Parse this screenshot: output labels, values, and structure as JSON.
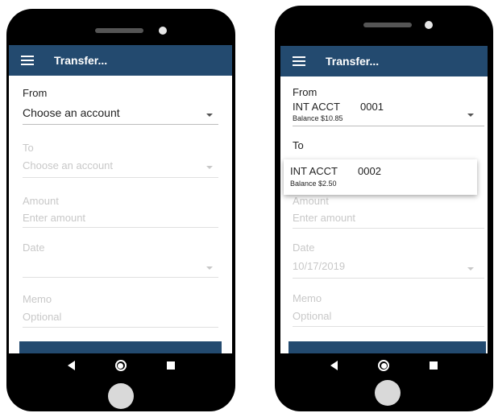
{
  "left": {
    "title": "Transfer...",
    "from_label": "From",
    "from_value": "Choose an account",
    "to_label": "To",
    "to_value": "Choose an account",
    "amount_label": "Amount",
    "amount_placeholder": "Enter amount",
    "date_label": "Date",
    "memo_label": "Memo",
    "memo_placeholder": "Optional"
  },
  "right": {
    "title": "Transfer...",
    "from_label": "From",
    "from_account_name": "INT ACCT",
    "from_account_number": "0001",
    "from_balance": "Balance $10.85",
    "to_label": "To",
    "option_account_name": "INT ACCT",
    "option_account_number": "0002",
    "option_balance": "Balance $2.50",
    "amount_label": "Amount",
    "amount_placeholder": "Enter amount",
    "date_label": "Date",
    "date_value": "10/17/2019",
    "memo_label": "Memo",
    "memo_placeholder": "Optional"
  },
  "colors": {
    "app_bar": "#234a6f",
    "phone_body": "#000000"
  },
  "icons": [
    "menu-icon",
    "caret-down-icon",
    "back-icon",
    "home-icon",
    "recents-icon"
  ]
}
